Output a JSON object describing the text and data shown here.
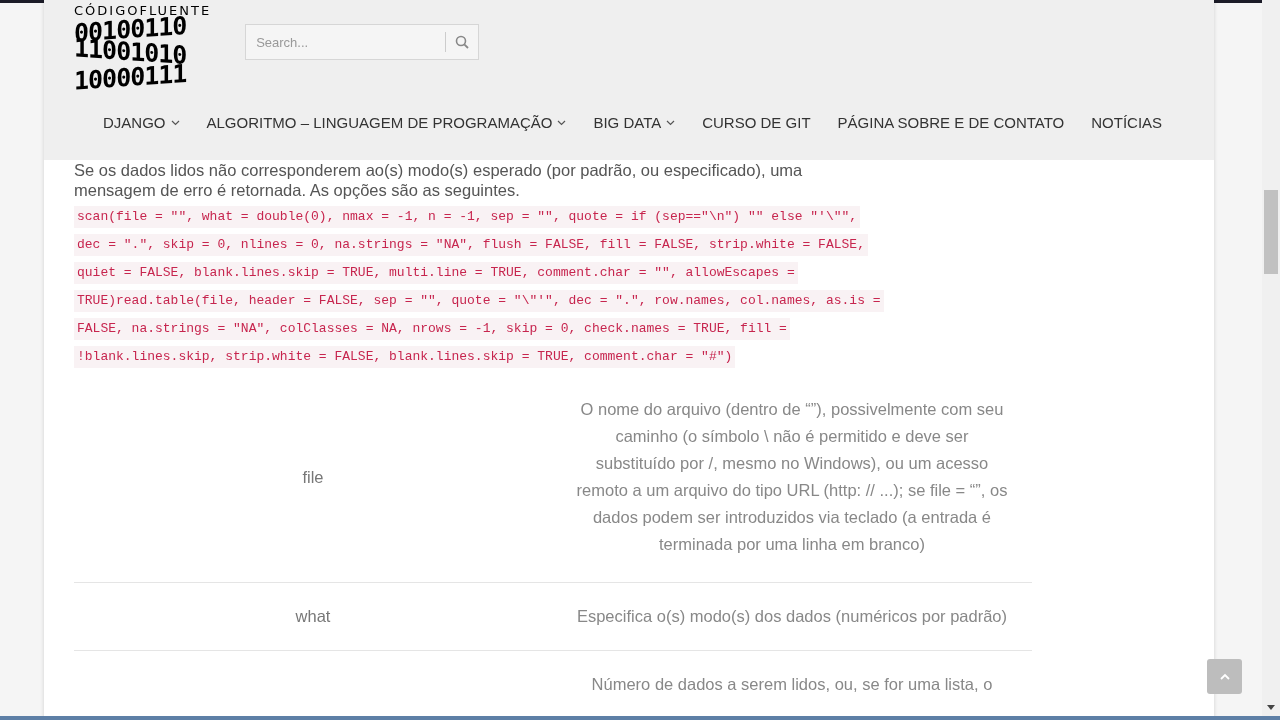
{
  "logo": {
    "name": "CÓDIGOFLUENTE",
    "digits": [
      "00100110",
      "11001010",
      "10000111"
    ]
  },
  "search": {
    "placeholder": "Search..."
  },
  "nav": [
    {
      "label": "DJANGO",
      "has_dropdown": true
    },
    {
      "label": "ALGORITMO – LINGUAGEM DE PROGRAMAÇÃO",
      "has_dropdown": true
    },
    {
      "label": "BIG DATA",
      "has_dropdown": true
    },
    {
      "label": "CURSO DE GIT",
      "has_dropdown": false
    },
    {
      "label": "PÁGINA SOBRE E DE CONTATO",
      "has_dropdown": false
    },
    {
      "label": "NOTÍCIAS",
      "has_dropdown": false
    }
  ],
  "intro": [
    "Se os dados lidos não corresponderem ao(s) modo(s) esperado (por padrão, ou especificado), uma",
    "mensagem de erro é retornada. As opções são as seguintes."
  ],
  "code_lines": [
    "scan(file = \"\", what = double(0), nmax = -1, n = -1, sep = \"\", quote = if (sep==\"\\n\") \"\" else \"'\\\"\",",
    "dec = \".\", skip = 0, nlines = 0, na.strings = \"NA\", flush = FALSE, fill = FALSE, strip.white = FALSE,",
    "quiet = FALSE, blank.lines.skip = TRUE, multi.line = TRUE, comment.char = \"\", allowEscapes =",
    "TRUE)read.table(file, header = FALSE, sep = \"\", quote = \"\\\"'\", dec = \".\", row.names, col.names, as.is =",
    "FALSE, na.strings = \"NA\", colClasses = NA, nrows = -1, skip = 0, check.names = TRUE, fill =",
    "!blank.lines.skip, strip.white = FALSE, blank.lines.skip = TRUE, comment.char = \"#\")"
  ],
  "table": {
    "rows": [
      {
        "name": "file",
        "description": [
          "O nome do arquivo (dentro de “”), possivelmente com seu",
          "caminho (o símbolo \\ não é permitido e deve ser",
          "substituído por /, mesmo no Windows), ou um acesso",
          "remoto a um arquivo do tipo URL (http: // ...); se file = “”, os",
          "dados podem ser introduzidos via teclado (a entrada é",
          "terminada por uma linha em branco)"
        ]
      },
      {
        "name": "what",
        "description": [
          "Especifica o(s) modo(s) dos dados (numéricos por padrão)"
        ]
      },
      {
        "description": [
          "Número de dados a serem lidos, ou, se for uma lista, o"
        ]
      }
    ]
  }
}
